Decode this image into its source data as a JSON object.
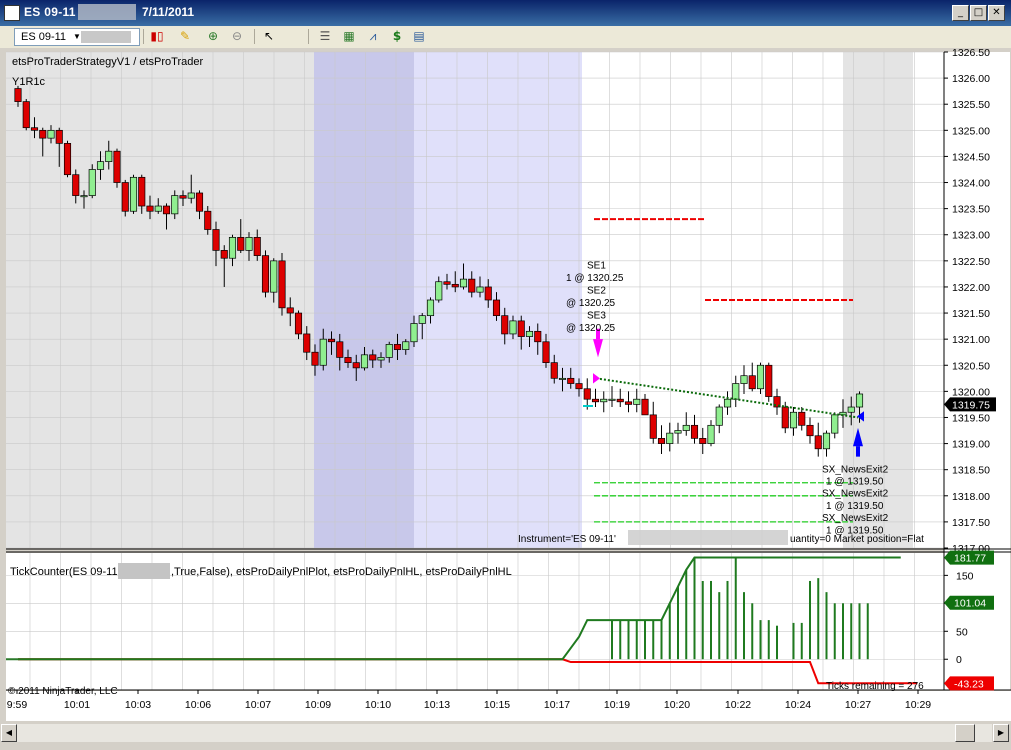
{
  "window": {
    "title_symbol": "ES 09-11",
    "title_date": "7/11/2011",
    "minimize": "_",
    "maximize": "□",
    "close": "✕"
  },
  "toolbar": {
    "instrument": "ES 09-11",
    "icons": [
      "candlestick-style-icon",
      "pencil-draw-icon",
      "zoom-in-icon",
      "zoom-out-icon",
      "cursor-select-icon",
      "properties-icon",
      "bar-chart-icon",
      "line-chart-icon",
      "dollar-icon",
      "data-box-icon"
    ]
  },
  "chart_data": [
    {
      "type": "candlestick",
      "strategy_label": "etsProTraderStrategyV1 / etsProTrader",
      "series_label": "Y1R1c",
      "ylim": [
        1317.0,
        1326.5
      ],
      "y_ticks": [
        "1326.50",
        "1326.00",
        "1325.50",
        "1325.00",
        "1324.50",
        "1324.00",
        "1323.50",
        "1323.00",
        "1322.50",
        "1322.00",
        "1321.50",
        "1321.00",
        "1320.50",
        "1320.00",
        "1319.50",
        "1319.00",
        "1318.50",
        "1318.00",
        "1317.50",
        "1317.00"
      ],
      "last_price": "1319.75",
      "x_ticks": [
        "9:59",
        "10:01",
        "10:03",
        "10:06",
        "10:07",
        "10:09",
        "10:10",
        "10:13",
        "10:15",
        "10:17",
        "10:19",
        "10:20",
        "10:22",
        "10:24",
        "10:27",
        "10:29"
      ],
      "colors": {
        "up": "#90ee90",
        "down": "#dd0000",
        "session_gray": "#e4e4e4",
        "session_blue": "#e0e0fa",
        "session_blue_dark": "#c8c8ea"
      },
      "bars": [
        [
          1325.8,
          1325.85,
          1325.45,
          1325.55
        ],
        [
          1325.55,
          1325.6,
          1325.0,
          1325.05
        ],
        [
          1325.05,
          1325.25,
          1324.85,
          1325.0
        ],
        [
          1325.0,
          1325.05,
          1324.5,
          1324.85
        ],
        [
          1324.85,
          1325.1,
          1324.75,
          1325.0
        ],
        [
          1325.0,
          1325.05,
          1324.3,
          1324.75
        ],
        [
          1324.75,
          1324.8,
          1324.1,
          1324.15
        ],
        [
          1324.15,
          1324.25,
          1323.6,
          1323.75
        ],
        [
          1323.75,
          1323.85,
          1323.5,
          1323.75
        ],
        [
          1323.75,
          1324.35,
          1323.7,
          1324.25
        ],
        [
          1324.25,
          1324.6,
          1324.05,
          1324.4
        ],
        [
          1324.4,
          1324.8,
          1324.25,
          1324.6
        ],
        [
          1324.6,
          1324.65,
          1323.9,
          1324.0
        ],
        [
          1324.0,
          1324.05,
          1323.35,
          1323.45
        ],
        [
          1323.45,
          1324.15,
          1323.4,
          1324.1
        ],
        [
          1324.1,
          1324.15,
          1323.4,
          1323.55
        ],
        [
          1323.55,
          1323.75,
          1323.3,
          1323.45
        ],
        [
          1323.45,
          1323.7,
          1323.4,
          1323.55
        ],
        [
          1323.55,
          1323.6,
          1323.1,
          1323.4
        ],
        [
          1323.4,
          1323.85,
          1323.3,
          1323.75
        ],
        [
          1323.75,
          1323.85,
          1323.55,
          1323.7
        ],
        [
          1323.7,
          1324.15,
          1323.6,
          1323.8
        ],
        [
          1323.8,
          1323.85,
          1323.3,
          1323.45
        ],
        [
          1323.45,
          1323.55,
          1323.0,
          1323.1
        ],
        [
          1323.1,
          1323.25,
          1322.4,
          1322.7
        ],
        [
          1322.7,
          1322.8,
          1322.0,
          1322.55
        ],
        [
          1322.55,
          1323.0,
          1322.4,
          1322.95
        ],
        [
          1322.95,
          1323.3,
          1322.65,
          1322.7
        ],
        [
          1322.7,
          1323.05,
          1322.5,
          1322.95
        ],
        [
          1322.95,
          1323.1,
          1322.5,
          1322.6
        ],
        [
          1322.6,
          1322.7,
          1321.8,
          1321.9
        ],
        [
          1321.9,
          1322.55,
          1321.7,
          1322.5
        ],
        [
          1322.5,
          1322.65,
          1321.45,
          1321.6
        ],
        [
          1321.6,
          1321.8,
          1321.25,
          1321.5
        ],
        [
          1321.5,
          1321.55,
          1321.0,
          1321.1
        ],
        [
          1321.1,
          1321.25,
          1320.6,
          1320.75
        ],
        [
          1320.75,
          1320.9,
          1320.3,
          1320.5
        ],
        [
          1320.5,
          1321.2,
          1320.4,
          1321.0
        ],
        [
          1321.0,
          1321.15,
          1320.7,
          1320.95
        ],
        [
          1320.95,
          1321.1,
          1320.4,
          1320.65
        ],
        [
          1320.65,
          1320.8,
          1320.45,
          1320.55
        ],
        [
          1320.55,
          1320.7,
          1320.2,
          1320.45
        ],
        [
          1320.45,
          1320.85,
          1320.4,
          1320.7
        ],
        [
          1320.7,
          1320.8,
          1320.45,
          1320.6
        ],
        [
          1320.6,
          1320.75,
          1320.45,
          1320.65
        ],
        [
          1320.65,
          1320.95,
          1320.55,
          1320.9
        ],
        [
          1320.9,
          1321.1,
          1320.6,
          1320.8
        ],
        [
          1320.8,
          1321.0,
          1320.7,
          1320.95
        ],
        [
          1320.95,
          1321.45,
          1320.85,
          1321.3
        ],
        [
          1321.3,
          1321.5,
          1321.0,
          1321.45
        ],
        [
          1321.45,
          1321.8,
          1321.3,
          1321.75
        ],
        [
          1321.75,
          1322.2,
          1321.7,
          1322.1
        ],
        [
          1322.1,
          1322.25,
          1321.95,
          1322.05
        ],
        [
          1322.05,
          1322.3,
          1321.9,
          1322.0
        ],
        [
          1322.0,
          1322.45,
          1321.95,
          1322.15
        ],
        [
          1322.15,
          1322.3,
          1321.8,
          1321.9
        ],
        [
          1321.9,
          1322.2,
          1321.8,
          1322.0
        ],
        [
          1322.0,
          1322.15,
          1321.6,
          1321.75
        ],
        [
          1321.75,
          1321.9,
          1321.35,
          1321.45
        ],
        [
          1321.45,
          1321.6,
          1320.9,
          1321.1
        ],
        [
          1321.1,
          1321.45,
          1321.0,
          1321.35
        ],
        [
          1321.35,
          1321.45,
          1320.8,
          1321.05
        ],
        [
          1321.05,
          1321.25,
          1320.85,
          1321.15
        ],
        [
          1321.15,
          1321.3,
          1320.7,
          1320.95
        ],
        [
          1320.95,
          1321.1,
          1320.45,
          1320.55
        ],
        [
          1320.55,
          1320.7,
          1320.15,
          1320.25
        ],
        [
          1320.25,
          1320.45,
          1320.0,
          1320.25
        ],
        [
          1320.25,
          1320.45,
          1320.05,
          1320.15
        ],
        [
          1320.15,
          1320.25,
          1319.9,
          1320.05
        ],
        [
          1320.05,
          1320.25,
          1319.65,
          1319.85
        ],
        [
          1319.85,
          1320.05,
          1319.7,
          1319.8
        ],
        [
          1319.8,
          1320.0,
          1319.6,
          1319.85
        ],
        [
          1319.85,
          1320.1,
          1319.7,
          1319.85
        ],
        [
          1319.85,
          1320.05,
          1319.7,
          1319.8
        ],
        [
          1319.8,
          1320.0,
          1319.6,
          1319.75
        ],
        [
          1319.75,
          1320.05,
          1319.6,
          1319.85
        ],
        [
          1319.85,
          1319.95,
          1319.55,
          1319.55
        ],
        [
          1319.55,
          1319.8,
          1319.0,
          1319.1
        ],
        [
          1319.1,
          1319.35,
          1318.8,
          1319.0
        ],
        [
          1319.0,
          1319.4,
          1318.85,
          1319.2
        ],
        [
          1319.2,
          1319.4,
          1319.0,
          1319.25
        ],
        [
          1319.25,
          1319.6,
          1319.15,
          1319.35
        ],
        [
          1319.35,
          1319.55,
          1319.0,
          1319.1
        ],
        [
          1319.1,
          1319.3,
          1318.8,
          1319.0
        ],
        [
          1319.0,
          1319.45,
          1318.95,
          1319.35
        ],
        [
          1319.35,
          1319.75,
          1319.2,
          1319.7
        ],
        [
          1319.7,
          1320.0,
          1319.55,
          1319.85
        ],
        [
          1319.85,
          1320.3,
          1319.7,
          1320.15
        ],
        [
          1320.15,
          1320.5,
          1319.95,
          1320.3
        ],
        [
          1320.3,
          1320.55,
          1320.0,
          1320.05
        ],
        [
          1320.05,
          1320.55,
          1319.95,
          1320.5
        ],
        [
          1320.5,
          1320.55,
          1319.8,
          1319.9
        ],
        [
          1319.9,
          1320.05,
          1319.55,
          1319.7
        ],
        [
          1319.7,
          1319.8,
          1319.2,
          1319.3
        ],
        [
          1319.3,
          1319.7,
          1319.15,
          1319.6
        ],
        [
          1319.6,
          1319.7,
          1319.25,
          1319.35
        ],
        [
          1319.35,
          1319.5,
          1319.0,
          1319.15
        ],
        [
          1319.15,
          1319.4,
          1318.75,
          1318.9
        ],
        [
          1318.9,
          1319.25,
          1318.75,
          1319.2
        ],
        [
          1319.2,
          1319.6,
          1319.1,
          1319.55
        ],
        [
          1319.55,
          1319.85,
          1319.3,
          1319.6
        ],
        [
          1319.6,
          1319.9,
          1319.35,
          1319.7
        ],
        [
          1319.7,
          1320.0,
          1319.4,
          1319.95
        ]
      ],
      "entry_label": {
        "lines": [
          "SE1",
          "1 @ 1320.25",
          "SE2",
          "@ 1320.25",
          "SE3",
          "@ 1320.25"
        ]
      },
      "exit_label": {
        "lines": [
          "SX_NewsExit2",
          "1 @ 1319.50",
          "SX_NewsExit2",
          "1 @ 1319.50",
          "SX_NewsExit2",
          "1 @ 1319.50"
        ]
      },
      "levels": {
        "red_upper": 1323.3,
        "red_mid": 1321.75,
        "green_targets": [
          1318.25,
          1318.0,
          1317.5
        ],
        "trend_start": 1320.25,
        "trend_end": 1319.5
      },
      "instrument_text": "Instrument='ES 09-11'",
      "position_text": "uantity=0 Market position=Flat"
    },
    {
      "type": "line",
      "indicator_label": "TickCounter(ES 09-11",
      "indicator_label_tail": ",True,False),  etsProDailyPnlPlot,  etsProDailyPnlHL,  etsProDailyPnlHL",
      "ylim": [
        -55,
        190
      ],
      "y_ticks": [
        "150",
        "100",
        "50",
        "0"
      ],
      "badges": [
        {
          "value": "181.77",
          "color": "#107010"
        },
        {
          "value": "101.04",
          "color": "#107010"
        },
        {
          "value": "-43.23",
          "color": "#ee0000"
        }
      ],
      "copyright": "© 2011 NinjaTrader, LLC",
      "ticks_remaining": "Ticks remaining = 276",
      "pnl_hl_high": [
        0,
        0,
        0,
        0,
        0,
        0,
        0,
        0,
        0,
        0,
        0,
        0,
        0,
        0,
        0,
        0,
        0,
        0,
        0,
        0,
        0,
        0,
        0,
        0,
        0,
        0,
        0,
        0,
        0,
        0,
        0,
        0,
        0,
        0,
        0,
        0,
        0,
        0,
        0,
        0,
        0,
        0,
        0,
        0,
        0,
        0,
        0,
        0,
        0,
        0,
        0,
        0,
        0,
        0,
        0,
        0,
        0,
        0,
        0,
        0,
        0,
        0,
        0,
        0,
        0,
        0,
        0,
        20,
        40,
        70,
        70,
        70,
        70,
        70,
        70,
        70,
        70,
        70,
        70,
        100,
        130,
        160,
        182,
        182,
        182,
        182,
        182,
        182,
        182,
        182,
        182,
        182,
        182,
        182,
        182,
        182,
        182,
        182,
        182,
        182,
        182,
        182,
        182,
        182,
        182,
        182,
        182,
        182
      ],
      "pnl_hl_low": [
        0,
        0,
        0,
        0,
        0,
        0,
        0,
        0,
        0,
        0,
        0,
        0,
        0,
        0,
        0,
        0,
        0,
        0,
        0,
        0,
        0,
        0,
        0,
        0,
        0,
        0,
        0,
        0,
        0,
        0,
        0,
        0,
        0,
        0,
        0,
        0,
        0,
        0,
        0,
        0,
        0,
        0,
        0,
        0,
        0,
        0,
        0,
        0,
        0,
        0,
        0,
        0,
        0,
        0,
        0,
        0,
        0,
        0,
        0,
        0,
        0,
        0,
        0,
        0,
        0,
        0,
        0,
        -5,
        -5,
        -5,
        -5,
        -5,
        -5,
        -5,
        -5,
        -5,
        -5,
        -5,
        -5,
        -5,
        -5,
        -5,
        -5,
        -5,
        -5,
        -5,
        -5,
        -5,
        -5,
        -5,
        -5,
        -5,
        -5,
        -5,
        -5,
        -5,
        -5,
        -43,
        -43,
        -43,
        -43,
        -43,
        -43,
        -43,
        -43,
        -43,
        -43,
        -43,
        -43,
        -43
      ],
      "pnl_bars": [
        {
          "x": 72,
          "v": 70
        },
        {
          "x": 73,
          "v": 70
        },
        {
          "x": 74,
          "v": 70
        },
        {
          "x": 75,
          "v": 70
        },
        {
          "x": 76,
          "v": 70
        },
        {
          "x": 77,
          "v": 70
        },
        {
          "x": 78,
          "v": 70
        },
        {
          "x": 79,
          "v": 100
        },
        {
          "x": 80,
          "v": 130
        },
        {
          "x": 81,
          "v": 160
        },
        {
          "x": 82,
          "v": 182
        },
        {
          "x": 83,
          "v": 140
        },
        {
          "x": 84,
          "v": 140
        },
        {
          "x": 85,
          "v": 120
        },
        {
          "x": 86,
          "v": 140
        },
        {
          "x": 87,
          "v": 182
        },
        {
          "x": 88,
          "v": 120
        },
        {
          "x": 89,
          "v": 100
        },
        {
          "x": 90,
          "v": 70
        },
        {
          "x": 91,
          "v": 70
        },
        {
          "x": 92,
          "v": 60
        },
        {
          "x": 94,
          "v": 65
        },
        {
          "x": 95,
          "v": 65
        },
        {
          "x": 96,
          "v": 140
        },
        {
          "x": 97,
          "v": 145
        },
        {
          "x": 98,
          "v": 120
        },
        {
          "x": 99,
          "v": 100
        },
        {
          "x": 100,
          "v": 100
        },
        {
          "x": 101,
          "v": 100
        },
        {
          "x": 102,
          "v": 100
        },
        {
          "x": 103,
          "v": 100
        }
      ]
    }
  ]
}
